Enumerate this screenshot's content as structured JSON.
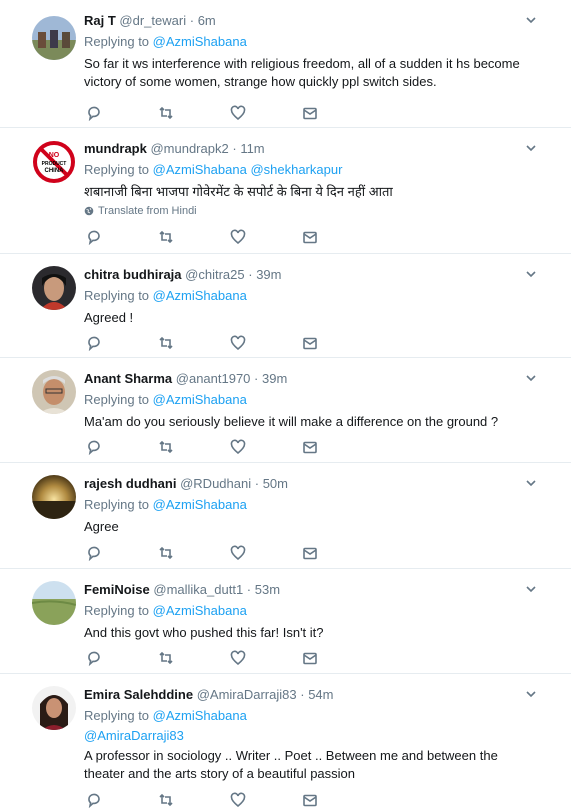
{
  "tweets": [
    {
      "name": "Raj T",
      "handle": "@dr_tewari",
      "time": "6m",
      "replying_label": "Replying to",
      "mentions": [
        "@AzmiShabana"
      ],
      "text": "So far it ws interference with religious freedom, all of a sudden it hs become victory of some women, strange how quickly ppl switch sides."
    },
    {
      "name": "mundrapk",
      "handle": "@mundrapk2",
      "time": "11m",
      "replying_label": "Replying to",
      "mentions": [
        "@AzmiShabana",
        "@shekharkapur"
      ],
      "text": "शबानाजी बिना भाजपा गोवेरमेंट के सपोर्ट के बिना ये दिन नहीं आता",
      "translate": "Translate from Hindi",
      "avatar_text": "NO PRODUCT CHINA"
    },
    {
      "name": "chitra budhiraja",
      "handle": "@chitra25",
      "time": "39m",
      "replying_label": "Replying to",
      "mentions": [
        "@AzmiShabana"
      ],
      "text": "Agreed !"
    },
    {
      "name": "Anant Sharma",
      "handle": "@anant1970",
      "time": "39m",
      "replying_label": "Replying to",
      "mentions": [
        "@AzmiShabana"
      ],
      "text": "Ma'am do you seriously believe it will make a difference on the ground ?"
    },
    {
      "name": "rajesh dudhani",
      "handle": "@RDudhani",
      "time": "50m",
      "replying_label": "Replying to",
      "mentions": [
        "@AzmiShabana"
      ],
      "text": "Agree"
    },
    {
      "name": "FemiNoise",
      "handle": "@mallika_dutt1",
      "time": "53m",
      "replying_label": "Replying to",
      "mentions": [
        "@AzmiShabana"
      ],
      "text": "And this govt who pushed this far! Isn't it?"
    },
    {
      "name": "Emira Salehddine",
      "handle": "@AmiraDarraji83",
      "time": "54m",
      "replying_label": "Replying to",
      "mentions": [
        "@AzmiShabana"
      ],
      "mention_line": "@AmiraDarraji83",
      "text": "A professor in sociology .. Writer .. Poet .. Between me and between the theater and the arts story of a beautiful passion"
    }
  ],
  "colors": {
    "link": "#1da1f2",
    "muted": "#657786",
    "border": "#e6ecf0"
  }
}
